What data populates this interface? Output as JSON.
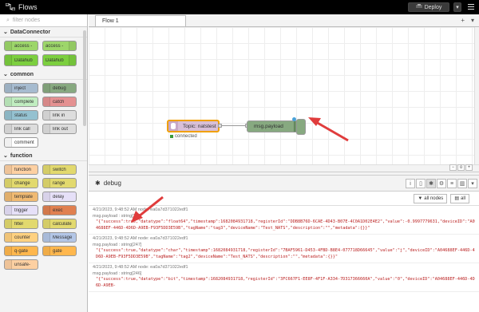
{
  "header": {
    "title": "Flows",
    "deploy_label": "Deploy"
  },
  "palette": {
    "search_placeholder": "filter nodes",
    "categories": [
      {
        "name": "DataConnector",
        "rows": [
          [
            "access -",
            "access -"
          ],
          [
            "Datahub",
            "Datahub"
          ]
        ]
      },
      {
        "name": "common",
        "rows": [
          [
            "inject",
            "debug"
          ],
          [
            "complete",
            "catch"
          ],
          [
            "status",
            "link in"
          ],
          [
            "link call",
            "link out"
          ],
          [
            "comment",
            ""
          ]
        ]
      },
      {
        "name": "function",
        "rows": [
          [
            "function",
            "switch"
          ],
          [
            "change",
            "range"
          ],
          [
            "template",
            "delay"
          ],
          [
            "trigger",
            "exec"
          ],
          [
            "filter",
            "calculate"
          ],
          [
            "counter",
            "Message"
          ],
          [
            "q-gate",
            "gate"
          ],
          [
            "unsafe-",
            ""
          ]
        ]
      }
    ]
  },
  "workspace": {
    "tab": "Flow 1",
    "nodes": {
      "inject_label": "Topic: natstest",
      "inject_status": "connected",
      "debug_label": "msg.payload"
    }
  },
  "debug": {
    "tab_label": "debug",
    "filter_label": "all nodes",
    "clear_label": "all",
    "messages": [
      {
        "meta": "4/21/2023, 9:48:52 AM    node: ea0a7d371022edf1",
        "type": "msg.payload : string[239]",
        "payload": "\"{\"success\":true,\"datatype\":\"float64\",\"timestamp\":1682084931718,\"registerId\":\"DDB8B76D-6CAE-4D43-B07E-4C0A1D02E4E2\",\"value\":-0.9997779631,\"deviceID\":\"A04688EF-446D-4D6D-A9EB-F93F5DD3E59B\",\"tagName\":\"tag3\",\"deviceName\":\"Test_NATS\",\"description\":\"\",\"metadata\":{}}\""
      },
      {
        "meta": "4/21/2023, 9:48:52 AM    node: ea0a7d371022edf1",
        "type": "msg.payload : string[247]",
        "payload": "\"{\"success\":true,\"datatype\":\"char\",\"timestamp\":1682084931718,\"registerId\":\"7BAF5961-D453-4FBD-B8E4-077718D66645\",\"value\":\"j\",\"deviceID\":\"A04688EF-446D-4D6D-A9EB-F93F5DD3E59B\",\"tagName\":\"tag2\",\"deviceName\":\"Test_NATS\",\"description\":\"\",\"metadata\":{}}\""
      },
      {
        "meta": "4/21/2023, 9:48:52 AM    node: ea0a7d371022edf1",
        "type": "msg.payload : string[246]",
        "payload": "\"{\"success\":true,\"datatype\":\"bit\",\"timestamp\":1682084931718,\"registerId\":\"3FC667F1-EE8F-4F1F-A334-7D317366660A\",\"value\":\"0\",\"deviceID\":\"A04688EF-446D-4D6D-A9EB-"
      }
    ]
  },
  "colors": {
    "header": "#000000",
    "inject": "#d8bfd8",
    "debug_node": "#87a980",
    "payload_text": "#b22222",
    "arrow": "#e03c3c"
  }
}
